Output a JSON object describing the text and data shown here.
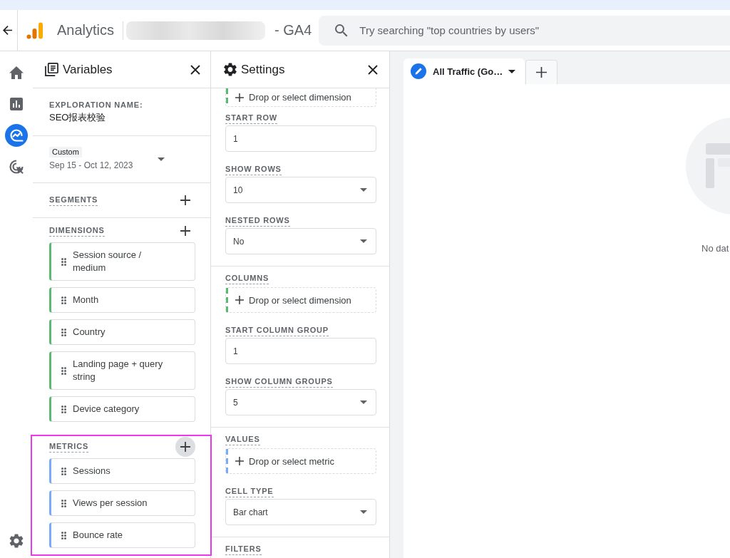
{
  "header": {
    "app_name": "Analytics",
    "property_name": "- GA4",
    "search": {
      "placeholder": "Try searching \"top countries by users\""
    }
  },
  "nav_rail": [
    {
      "selected": false
    },
    {
      "selected": false
    },
    {
      "selected": true
    },
    {
      "selected": false
    }
  ],
  "variables_panel": {
    "title": "Variables",
    "exploration_name": {
      "label": "EXPLORATION NAME:",
      "value": "SEO报表校验"
    },
    "date_range": {
      "preset": "Custom",
      "range": "Sep 15 - Oct 12, 2023"
    },
    "sections": [
      {
        "kind": "segment",
        "label": "SEGMENTS",
        "add_hovered": false,
        "highlighted": false
      },
      {
        "kind": "dimension",
        "label": "DIMENSIONS",
        "add_hovered": false,
        "highlighted": false,
        "items": [
          "Session source / medium",
          "Month",
          "Country",
          "Landing page + query string",
          "Device category"
        ]
      },
      {
        "kind": "metric",
        "label": "METRICS",
        "add_hovered": true,
        "highlighted": true,
        "items": [
          "Sessions",
          "Views per session",
          "Bounce rate"
        ]
      }
    ]
  },
  "settings_panel": {
    "title": "Settings",
    "groups": [
      {
        "fields": [
          {
            "kind": "dropzone",
            "color": "#5bb974",
            "text": "Drop or select dimension",
            "clipped": true
          },
          {
            "kind": "input",
            "label": "START ROW",
            "value": "1"
          },
          {
            "kind": "select",
            "label": "SHOW ROWS",
            "value": "10"
          },
          {
            "kind": "select",
            "label": "NESTED ROWS",
            "value": "No"
          }
        ]
      },
      {
        "fields": [
          {
            "kind": "dropzone",
            "label": "COLUMNS",
            "color": "#5bb974",
            "text": "Drop or select dimension",
            "clipped": false
          },
          {
            "kind": "input",
            "label": "START COLUMN GROUP",
            "value": "1"
          },
          {
            "kind": "select",
            "label": "SHOW COLUMN GROUPS",
            "value": "5"
          }
        ]
      },
      {
        "fields": [
          {
            "kind": "dropzone",
            "label": "VALUES",
            "color": "#7baaf7",
            "text": "Drop or select metric",
            "clipped": false
          },
          {
            "kind": "select",
            "label": "CELL TYPE",
            "value": "Bar chart"
          }
        ]
      },
      {
        "fields": [
          {
            "kind": "heading",
            "label": "FILTERS"
          }
        ]
      }
    ]
  },
  "canvas": {
    "tabs": [
      {
        "label": "All Traffic (Go…",
        "selected": true
      }
    ],
    "empty_message": "No dat"
  }
}
